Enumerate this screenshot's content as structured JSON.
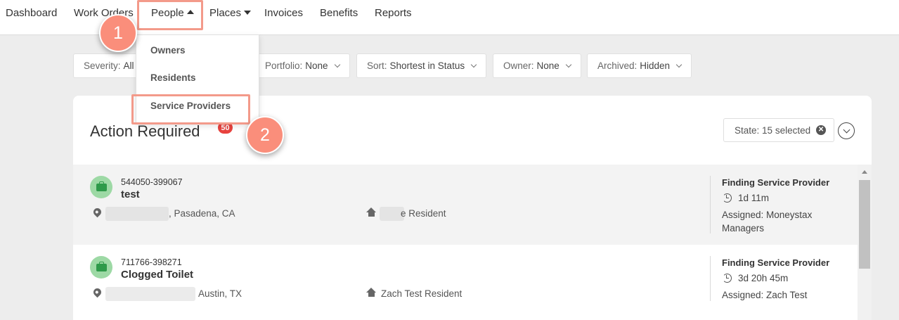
{
  "nav": {
    "items": [
      {
        "label": "Dashboard"
      },
      {
        "label": "Work Orders"
      },
      {
        "label": "People"
      },
      {
        "label": "Places"
      },
      {
        "label": "Invoices"
      },
      {
        "label": "Benefits"
      },
      {
        "label": "Reports"
      }
    ]
  },
  "people_menu": {
    "items": [
      {
        "label": "Owners"
      },
      {
        "label": "Residents"
      },
      {
        "label": "Service Providers"
      }
    ]
  },
  "filters": [
    {
      "label": "Severity:",
      "value": "All"
    },
    {
      "label": "Portfolio:",
      "value": "None"
    },
    {
      "label": "Sort:",
      "value": "Shortest in Status"
    },
    {
      "label": "Owner:",
      "value": "None"
    },
    {
      "label": "Archived:",
      "value": "Hidden"
    }
  ],
  "section": {
    "title": "Action Required",
    "count": "50",
    "state_filter": {
      "label": "State:",
      "value": "15 selected"
    }
  },
  "work_orders": [
    {
      "number": "544050-399067",
      "title": "test",
      "address": ", Pasadena, CA",
      "resident": "e Resident",
      "status": "Finding Service Provider",
      "duration": "1d 11m",
      "assigned": "Assigned: Moneystax Managers"
    },
    {
      "number": "711766-398271",
      "title": "Clogged Toilet",
      "address": "Austin, TX",
      "resident": "Zach Test Resident",
      "status": "Finding Service Provider",
      "duration": "3d 20h 45m",
      "assigned": "Assigned: Zach Test"
    }
  ],
  "tutorial": {
    "step1": "1",
    "step2": "2",
    "highlight_color": "#f39a8a",
    "marker_color": "#fa8e7b"
  },
  "icons": {
    "work_order": "briefcase-icon",
    "location": "map-pin-icon",
    "resident": "home-icon",
    "duration": "history-clock-icon",
    "clear": "close-circle-icon",
    "collapse": "chevron-down-circle-icon"
  }
}
